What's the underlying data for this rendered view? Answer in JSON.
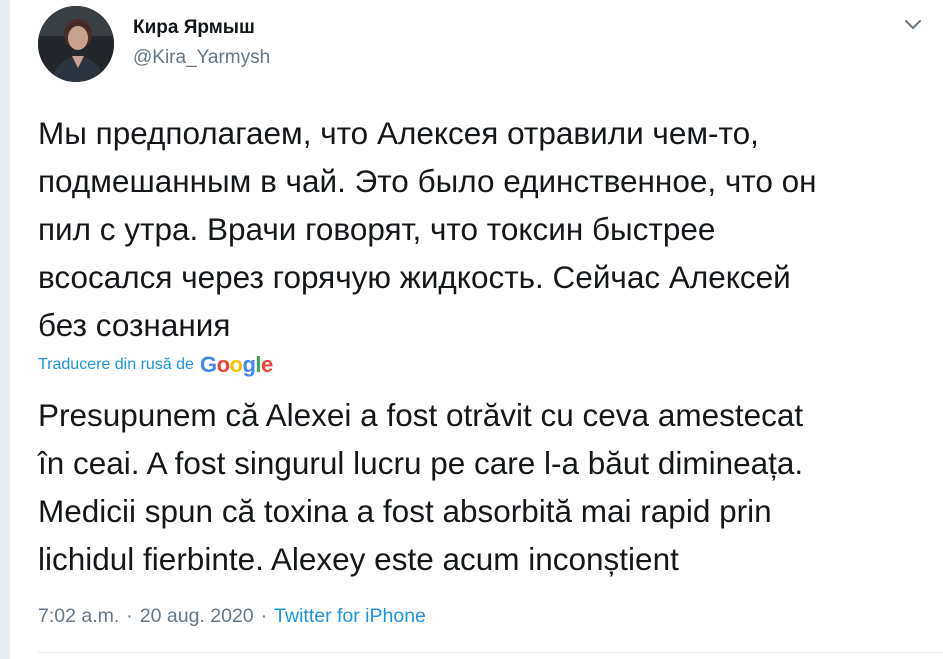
{
  "author": {
    "display_name": "Кира Ярмыш",
    "handle": "@Kira_Yarmysh",
    "avatar_icon": "user-avatar"
  },
  "menu": {
    "icon": "chevron-down-icon"
  },
  "tweet": {
    "text": "Мы предполагаем, что Алексея отравили чем-то,\nподмешанным в чай. Это было единственное, что он\nпил с утра. Врачи говорят, что токсин быстрее\nвсосался через горячую жидкость. Сейчас Алексей\nбез сознания"
  },
  "translation": {
    "label": "Traducere din rusă de",
    "provider": "Google",
    "text": "Presupunem că Alexei a fost otrăvit cu ceva amestecat\nîn ceai. A fost singurul lucru pe care l-a băut dimineața.\nMedicii spun că toxina a fost absorbită mai rapid prin\nlichidul fierbinte. Alexey este acum inconștient"
  },
  "meta": {
    "time": "7:02 a.m.",
    "separator": "·",
    "date": "20 aug. 2020",
    "source": "Twitter for iPhone"
  },
  "colors": {
    "text": "#14171a",
    "secondary": "#657786",
    "link": "#1b95e0",
    "divider": "#e6ecf0"
  }
}
